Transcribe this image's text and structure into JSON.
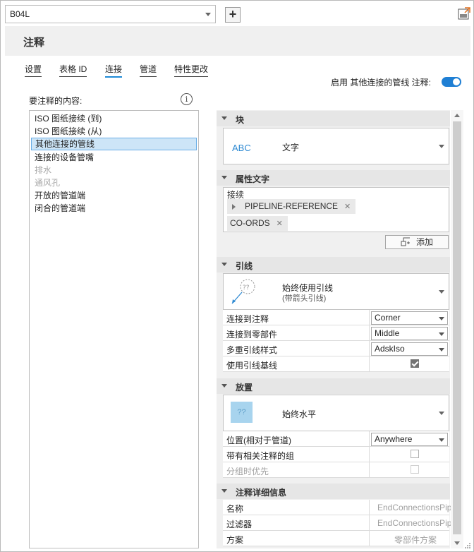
{
  "top": {
    "combo_value": "B04L",
    "plus_label": "+"
  },
  "header": {
    "title": "注释"
  },
  "tabs": [
    {
      "label": "设置"
    },
    {
      "label": "表格 ID"
    },
    {
      "label": "连接"
    },
    {
      "label": "管道"
    },
    {
      "label": "特性更改"
    }
  ],
  "enable_label": "启用 其他连接的管线 注释:",
  "left": {
    "label": "要注释的内容:",
    "items": [
      {
        "label": "ISO 图纸接续 (到)"
      },
      {
        "label": "ISO 图纸接续 (从)"
      },
      {
        "label": "其他连接的管线"
      },
      {
        "label": "连接的设备管嘴"
      },
      {
        "label": "排水"
      },
      {
        "label": "通风孔"
      },
      {
        "label": "开放的管道端"
      },
      {
        "label": "闭合的管道端"
      }
    ]
  },
  "sections": {
    "block": {
      "title": "块",
      "abc": "ABC",
      "value": "文字"
    },
    "attr": {
      "title": "属性文字",
      "sub": "接续",
      "chips": [
        "PIPELINE-REFERENCE",
        "CO-ORDS"
      ],
      "add_label": "添加"
    },
    "leader": {
      "title": "引线",
      "qq": "??",
      "main": "始终使用引线",
      "sub": "(带箭头引线)",
      "rows": [
        {
          "label": "连接到注释",
          "value": "Corner"
        },
        {
          "label": "连接到零部件",
          "value": "Middle"
        },
        {
          "label": "多重引线样式",
          "value": "AdskIso"
        },
        {
          "label": "使用引线基线"
        }
      ]
    },
    "placement": {
      "title": "放置",
      "qq": "??",
      "main": "始终水平",
      "rows": [
        {
          "label": "位置(相对于管道)",
          "value": "Anywhere"
        },
        {
          "label": "带有相关注释的组"
        },
        {
          "label": "分组时优先"
        }
      ]
    },
    "details": {
      "title": "注释详细信息",
      "rows": [
        {
          "label": "名称",
          "value": "EndConnectionsPipe"
        },
        {
          "label": "过滤器",
          "value": "EndConnectionsPipe"
        },
        {
          "label": "方案",
          "value": "零部件方案"
        }
      ]
    }
  },
  "colors": {
    "accent": "#1f7fd4",
    "selection": "#cde5f7",
    "abc": "#2f8ad2",
    "swatch": "#a8d4ee"
  }
}
